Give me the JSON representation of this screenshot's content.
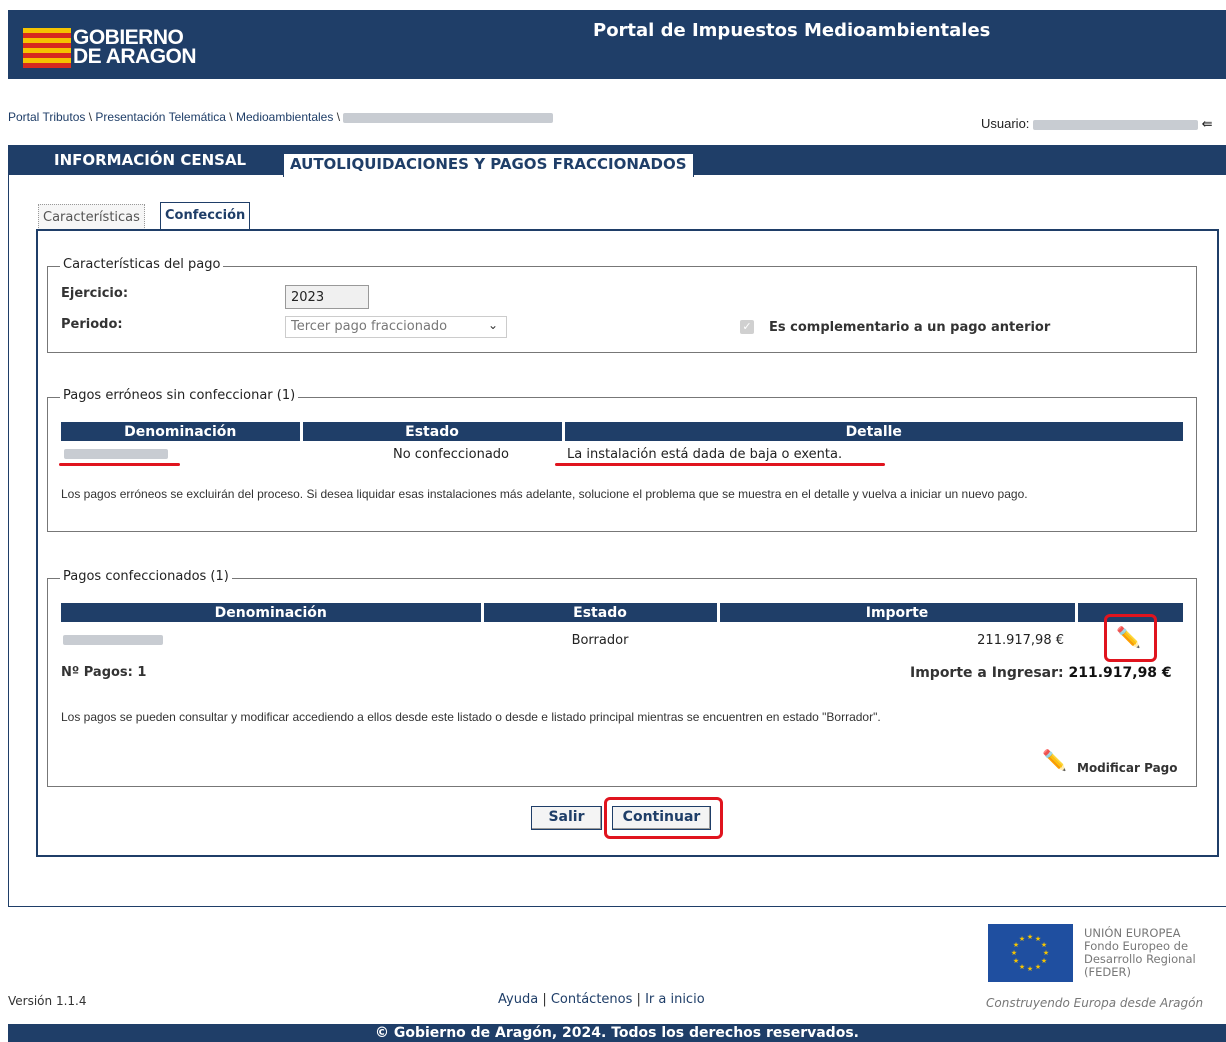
{
  "header": {
    "logo_line1": "GOBIERNO",
    "logo_line2": "DE ARAGON",
    "title": "Portal de Impuestos Medioambientales"
  },
  "breadcrumb": {
    "items": [
      "Portal Tributos",
      "Presentación Telemática",
      "Medioambientales"
    ],
    "separator": "\\"
  },
  "user": {
    "label": "Usuario:"
  },
  "main_tabs": [
    {
      "label": "INFORMACIÓN CENSAL"
    },
    {
      "label": "AUTOLIQUIDACIONES Y PAGOS FRACCIONADOS"
    }
  ],
  "sub_tabs": [
    {
      "label": "Características"
    },
    {
      "label": "Confección"
    }
  ],
  "pago": {
    "legend": "Características del pago",
    "ejercicio_label": "Ejercicio:",
    "ejercicio_value": "2023",
    "periodo_label": "Periodo:",
    "periodo_value": "Tercer pago fraccionado",
    "complementario_label": "Es complementario a un pago anterior"
  },
  "erroneos": {
    "legend": "Pagos erróneos sin confeccionar (1)",
    "headers": [
      "Denominación",
      "Estado",
      "Detalle"
    ],
    "row": {
      "estado": "No confeccionado",
      "detalle": "La instalación está dada de baja o exenta."
    },
    "note": "Los pagos erróneos se excluirán del proceso. Si desea liquidar esas instalaciones más adelante, solucione el problema que se muestra en el detalle y vuelva a iniciar un nuevo pago."
  },
  "confeccionados": {
    "legend": "Pagos confeccionados (1)",
    "headers": [
      "Denominación",
      "Estado",
      "Importe",
      ""
    ],
    "row": {
      "estado": "Borrador",
      "importe": "211.917,98 €"
    },
    "num_pagos": "Nº Pagos: 1",
    "total_label": "Importe a Ingresar:",
    "total_value": "211.917,98 €",
    "note": "Los pagos se pueden consultar y modificar accediendo a ellos desde este listado o desde e listado principal mientras se encuentren en estado \"Borrador\".",
    "modify_label": "Modificar Pago"
  },
  "buttons": {
    "salir": "Salir",
    "continuar": "Continuar"
  },
  "footer": {
    "version": "Versión 1.1.4",
    "ayuda": "Ayuda",
    "contactenos": "Contáctenos",
    "ir_inicio": "Ir a inicio",
    "sep": "|",
    "eu_line1": "UNIÓN EUROPEA",
    "eu_line2": "Fondo Europeo de",
    "eu_line3": "Desarrollo Regional",
    "eu_line4": "(FEDER)",
    "eu_motto": "Construyendo Europa desde Aragón",
    "copyright": "© Gobierno de Aragón, 2024. Todos los derechos reservados."
  },
  "colors": {
    "primary": "#1f3e68",
    "highlight": "#e0141e",
    "flag_yellow": "#f5c400",
    "flag_red": "#d62b1f"
  }
}
